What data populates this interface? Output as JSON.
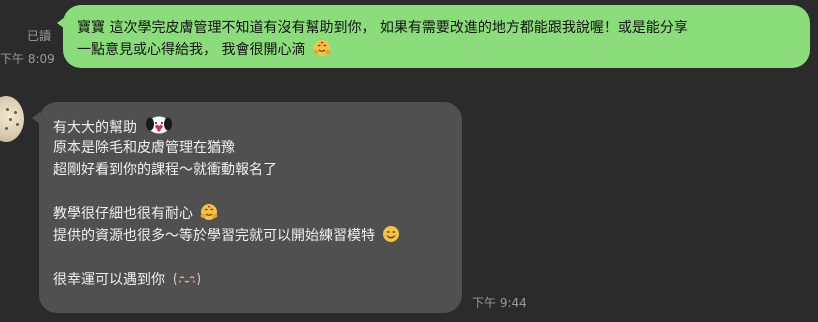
{
  "messages": [
    {
      "direction": "outgoing",
      "status": "已讀",
      "time": "下午 8:09",
      "lines": [
        "寶寶 這次學完皮膚管理不知道有沒有幫助到你， 如果有需要改進的地方都能跟我說喔！或是能分享",
        "一點意見或心得給我， 我會很開心滴"
      ],
      "emoji": "hug-face-emoji"
    },
    {
      "direction": "incoming",
      "time": "下午 9:44",
      "lines": [
        "有大大的幫助",
        "原本是除毛和皮膚管理在猶豫",
        "超剛好看到你的課程～就衝動報名了",
        "",
        "教學很仔細也很有耐心",
        "提供的資源也很多～等於學習完就可以開始練習模特",
        "",
        "很幸運可以遇到你"
      ],
      "emojis": [
        "snoopy-heart-sticker",
        "hug-face-emoji",
        "smiling-face-emoji",
        "shy-face-kaomoji"
      ]
    }
  ],
  "colors": {
    "background": "#2b2b2b",
    "outgoing_bubble": "#8bdc7a",
    "incoming_bubble": "#505050",
    "meta_text": "#9a9a9a"
  }
}
